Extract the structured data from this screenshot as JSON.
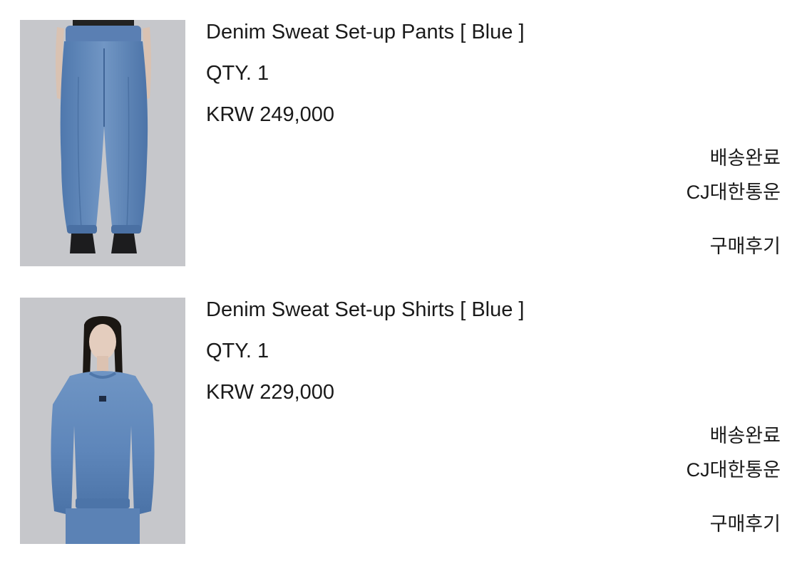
{
  "orders": [
    {
      "image_alt": "Denim Sweat Set-up Pants product photo",
      "name": "Denim Sweat Set-up Pants [ Blue ]",
      "qty": "QTY. 1",
      "price": "KRW 249,000",
      "status": "배송완료",
      "courier": "CJ대한통운",
      "review_label": "구매후기"
    },
    {
      "image_alt": "Denim Sweat Set-up Shirts product photo",
      "name": "Denim Sweat Set-up Shirts [ Blue ]",
      "qty": "QTY. 1",
      "price": "KRW 229,000",
      "status": "배송완료",
      "courier": "CJ대한통운",
      "review_label": "구매후기"
    }
  ],
  "colors": {
    "text": "#1a1a1a",
    "background": "#ffffff",
    "photo_backdrop": "#c6c7cb",
    "denim": "#5f86b8"
  }
}
